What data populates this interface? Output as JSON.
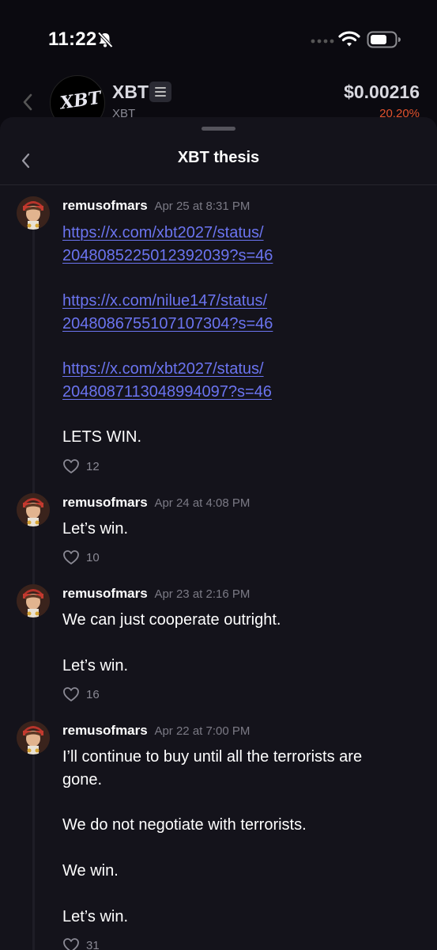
{
  "status_bar": {
    "time": "11:22"
  },
  "token": {
    "name": "XBT",
    "logo_text": "XBT",
    "ticker": "XBT",
    "price": "$0.00216",
    "change": "20.20%"
  },
  "sheet": {
    "title": "XBT thesis"
  },
  "posts": [
    {
      "author": "remusofmars",
      "time": "Apr 25 at 8:31 PM",
      "lines": [
        "https://x.com/xbt2027/status/",
        "2048085225012392039?s=46",
        "https://x.com/nilue147/status/",
        "2048086755107107304?s=46",
        "https://x.com/xbt2027/status/",
        "2048087113048994097?s=46",
        "LETS WIN."
      ],
      "likes": "12"
    },
    {
      "author": "remusofmars",
      "time": "Apr 24 at 4:08 PM",
      "lines": [
        "Let’s win."
      ],
      "likes": "10"
    },
    {
      "author": "remusofmars",
      "time": "Apr 23 at 2:16 PM",
      "lines": [
        "We can just cooperate outright.",
        "Let’s win."
      ],
      "likes": "16"
    },
    {
      "author": "remusofmars",
      "time": "Apr 22 at 7:00 PM",
      "lines": [
        "I’ll continue to buy until all the terrorists are",
        "gone.",
        "We do not negotiate with terrorists.",
        "We win.",
        "Let’s win."
      ],
      "likes": "31"
    }
  ],
  "colors": {
    "link": "#6b74f0",
    "negative_change": "#e0522e",
    "sheet_bg": "#14131b"
  },
  "icons": [
    "bell-slash-icon",
    "signal-icon",
    "wifi-icon",
    "battery-icon",
    "chevron-left-icon",
    "menu-icon",
    "heart-icon"
  ]
}
